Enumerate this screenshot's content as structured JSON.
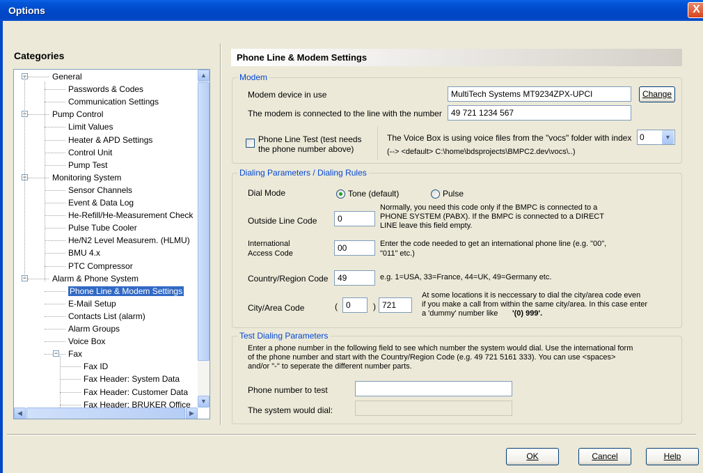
{
  "window": {
    "title": "Options",
    "close_glyph": "X"
  },
  "categories": {
    "heading": "Categories",
    "items": [
      {
        "label": "General",
        "level": 0,
        "expander": "−"
      },
      {
        "label": "Passwords & Codes",
        "level": 1
      },
      {
        "label": "Communication Settings",
        "level": 1
      },
      {
        "label": "Pump Control",
        "level": 0,
        "expander": "−"
      },
      {
        "label": "Limit Values",
        "level": 1
      },
      {
        "label": "Heater & APD Settings",
        "level": 1
      },
      {
        "label": "Control Unit",
        "level": 1
      },
      {
        "label": "Pump Test",
        "level": 1
      },
      {
        "label": "Monitoring System",
        "level": 0,
        "expander": "−"
      },
      {
        "label": "Sensor Channels",
        "level": 1
      },
      {
        "label": "Event & Data Log",
        "level": 1
      },
      {
        "label": "He-Refill/He-Measurement Check",
        "level": 1
      },
      {
        "label": "Pulse Tube Cooler",
        "level": 1
      },
      {
        "label": "He/N2 Level Measurem. (HLMU)",
        "level": 1
      },
      {
        "label": "BMU 4.x",
        "level": 1
      },
      {
        "label": "PTC Compressor",
        "level": 1
      },
      {
        "label": "Alarm & Phone System",
        "level": 0,
        "expander": "−"
      },
      {
        "label": "Phone Line & Modem Settings",
        "level": 1,
        "selected": true
      },
      {
        "label": "E-Mail Setup",
        "level": 1
      },
      {
        "label": "Contacts List (alarm)",
        "level": 1
      },
      {
        "label": "Alarm Groups",
        "level": 1
      },
      {
        "label": "Voice Box",
        "level": 1
      },
      {
        "label": "Fax",
        "level": 1,
        "expander": "−"
      },
      {
        "label": "Fax ID",
        "level": 2
      },
      {
        "label": "Fax Header: System Data",
        "level": 2
      },
      {
        "label": "Fax Header: Customer Data",
        "level": 2
      },
      {
        "label": "Fax Header: BRUKER Office",
        "level": 2
      }
    ],
    "scroll_up": "▲",
    "scroll_down": "▼",
    "scroll_left": "◀",
    "scroll_right": "▶"
  },
  "page_title": "Phone Line & Modem Settings",
  "modem": {
    "group_title": "Modem",
    "device_label": "Modem device in use",
    "device_value": "MultiTech Systems MT9234ZPX-UPCI",
    "change_label": "Change",
    "number_label": "The modem is connected to the line with the number",
    "number_value": "49 721 1234 567",
    "phone_test_label_1": "Phone Line Test (test needs",
    "phone_test_label_2": "the phone number above)",
    "voicebox_text": "The Voice Box is using voice files from the \"vocs\" folder with index",
    "voicebox_index": "0",
    "voicebox_arrow": "▼",
    "path_text": "(--> <default> C:\\home\\bdsprojects\\BMPC2.dev\\vocs\\..)"
  },
  "dialing": {
    "group_title": "Dialing Parameters / Dialing Rules",
    "dial_mode_label": "Dial Mode",
    "tone_label": "Tone (default)",
    "pulse_label": "Pulse",
    "selected_mode": "tone",
    "outside_label": "Outside Line Code",
    "outside_value": "0",
    "outside_help_1": "Normally, you need this code only if the BMPC is connected to a",
    "outside_help_2": "PHONE SYSTEM (PABX). If the BMPC is connected to a DIRECT",
    "outside_help_3": "LINE leave this field empty.",
    "intl_label_1": "International",
    "intl_label_2": "Access Code",
    "intl_value": "00",
    "intl_help_1": "Enter the code needed to get an international phone line (e.g. \"00\",",
    "intl_help_2": "\"011\" etc.)",
    "country_label": "Country/Region Code",
    "country_value": "49",
    "country_help": "e.g. 1=USA, 33=France, 44=UK, 49=Germany etc.",
    "city_label": "City/Area Code",
    "city_open": "(",
    "city_prefix_value": "0",
    "city_close": ")",
    "city_value": "721",
    "city_help_1": "At some locations it is neccessary to dial the city/area code even",
    "city_help_2": "if you make a call from within the same city/area. In this case enter",
    "city_help_3": "a 'dummy' number like",
    "city_help_example": "'(0) 999'."
  },
  "test": {
    "group_title": "Test Dialing Parameters",
    "intro_1": "Enter a phone number in the following field to see which number the system would dial. Use the international form",
    "intro_2": "of the phone number and start with the Country/Region Code (e.g. 49 721 5161 333). You can use <spaces>",
    "intro_3": "and/or \"-\" to seperate the different number parts.",
    "number_label": "Phone number to test",
    "number_value": "",
    "result_label": "The system would dial:",
    "result_value": ""
  },
  "buttons": {
    "ok": "OK",
    "cancel": "Cancel",
    "help": "Help"
  },
  "colors": {
    "title_bar": "#0049c9",
    "group_title": "#0046d5",
    "selection": "#316ac5",
    "radio_dot": "#21a121"
  }
}
